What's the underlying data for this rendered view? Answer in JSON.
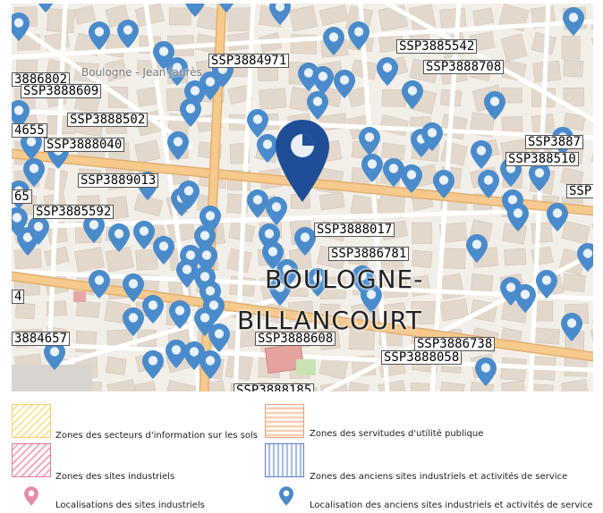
{
  "map": {
    "place_names": [
      {
        "id": "boulogne-billancourt-line1",
        "text": "BOULOGNE-"
      },
      {
        "id": "boulogne-billancourt-line2",
        "text": "BILLANCOURT"
      },
      {
        "id": "boulogne-jean-jaures",
        "text": "Boulogne - Jean Jaurès"
      }
    ],
    "site_labels": [
      "SSP3885542",
      "SSP3884971",
      "SSP3888708",
      "3886802",
      "SSP3888609",
      "SSP3888502",
      "4655",
      "SSP3888040",
      "SSP3887",
      "SSP388510",
      "SSP3889013",
      "SSP",
      "65",
      "SSP3885592",
      "SSP3888017",
      "SSP3886781",
      "4",
      "3884657",
      "SSP3888608",
      "SSP3886738",
      "SSP3888058",
      "SSP3888185"
    ],
    "colors": {
      "old_site_marker": "#4a8bcb",
      "selected_marker": "#1f4e96",
      "industrial_site_marker": "#e88ba8"
    }
  },
  "legend": {
    "items": [
      {
        "id": "sis",
        "label": "Zones des secteurs d'information sur les sols",
        "color": "#f2d264",
        "icon": "hatch-diagonal-yellow-icon"
      },
      {
        "id": "sup",
        "label": "Zones des servitudes d'utilité publique",
        "color": "#f0a070",
        "icon": "hatch-horizontal-orange-icon"
      },
      {
        "id": "si",
        "label": "Zones des sites industriels",
        "color": "#e8789c",
        "icon": "hatch-diagonal-pink-icon"
      },
      {
        "id": "asi",
        "label": "Zones des anciens sites industriels et activités de service",
        "color": "#5a82c8",
        "icon": "hatch-vertical-blue-icon"
      },
      {
        "id": "loc_si",
        "label": "Localisations des sites industriels",
        "color": "#e88ba8",
        "icon": "pink-pin-icon"
      },
      {
        "id": "loc_asi",
        "label": "Localisation des anciens sites industriels et activités de service",
        "color": "#4a8bcb",
        "icon": "blue-pin-icon"
      }
    ]
  }
}
